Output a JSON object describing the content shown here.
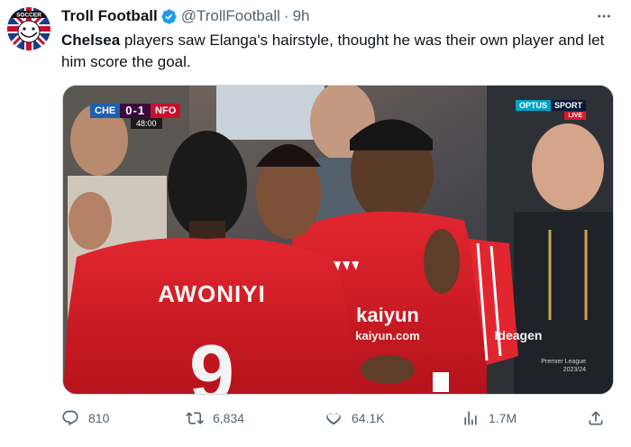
{
  "author": {
    "display_name": "Troll Football",
    "handle": "@TrollFootball",
    "separator": "·",
    "time": "9h",
    "avatar_icon": "troll-face-union-jack-avatar",
    "avatar_text": "SOCCER"
  },
  "tweet": {
    "bold_text": "Chelsea",
    "text": " players saw Elanga's hairstyle, thought he was their own player and let him score the goal."
  },
  "media": {
    "scorebug": {
      "home": "CHE",
      "home_score": "0",
      "away_score": "1",
      "away": "NFO",
      "clock": "48:00"
    },
    "broadcaster": {
      "brand_a": "OPTUS",
      "brand_b": "SPORT",
      "live": "LIVE"
    },
    "shirt_name": "AWONIYI",
    "shirt_number": "9",
    "sponsor": "kaiyun",
    "sponsor_sub": "kaiyun.com",
    "sleeve": "Ideagen",
    "watermark_line1": "Premier League",
    "watermark_line2": "2023/24"
  },
  "actions": {
    "replies": "810",
    "retweets": "6,834",
    "likes": "64.1K",
    "views": "1.7M"
  },
  "colors": {
    "text": "#0f1419",
    "secondary": "#536471",
    "verified": "#1d9bf0",
    "forest_red": "#d2222d"
  }
}
